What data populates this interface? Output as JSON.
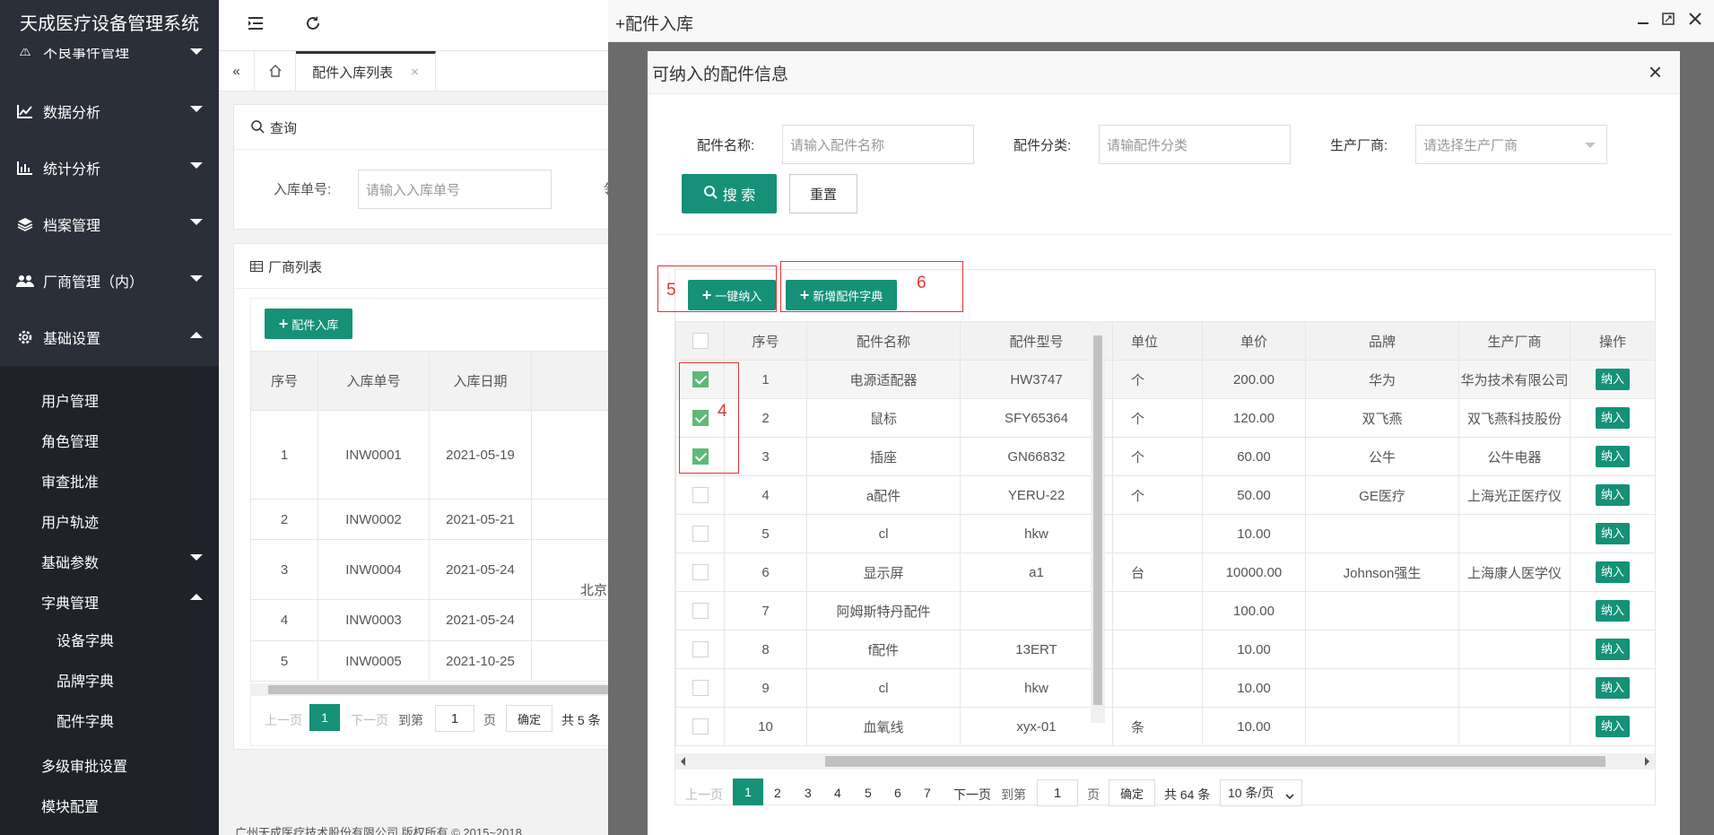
{
  "app": {
    "title": "天成医疗设备管理系统"
  },
  "sidebar": {
    "items": [
      {
        "label": "不良事件管理",
        "icon": "warning-icon"
      },
      {
        "label": "数据分析",
        "icon": "line-chart-icon"
      },
      {
        "label": "统计分析",
        "icon": "bar-chart-icon"
      },
      {
        "label": "档案管理",
        "icon": "layers-icon"
      },
      {
        "label": "厂商管理（内）",
        "icon": "users-icon"
      },
      {
        "label": "基础设置",
        "icon": "gear-icon"
      }
    ],
    "sub": [
      "用户管理",
      "角色管理",
      "审查批准",
      "用户轨迹",
      "基础参数",
      "字典管理"
    ],
    "sub2": [
      "设备字典",
      "品牌字典",
      "配件字典"
    ],
    "sub3": [
      "多级审批设置",
      "模块配置"
    ]
  },
  "tabs": {
    "active": "配件入库列表",
    "close": "×"
  },
  "query": {
    "title": "查询",
    "label": "入库单号:",
    "placeholder": "请输入入库单号",
    "cut": "领"
  },
  "list": {
    "title": "厂商列表",
    "add_btn": "配件入库",
    "headers": [
      "序号",
      "入库单号",
      "入库日期"
    ],
    "rows": [
      {
        "no": "1",
        "code": "INW0001",
        "date": "2021-05-19"
      },
      {
        "no": "2",
        "code": "INW0002",
        "date": "2021-05-21"
      },
      {
        "no": "3",
        "code": "INW0004",
        "date": "2021-05-24"
      },
      {
        "no": "4",
        "code": "INW0003",
        "date": "2021-05-24"
      },
      {
        "no": "5",
        "code": "INW0005",
        "date": "2021-10-25"
      }
    ],
    "extra": "北京六",
    "pager": {
      "prev": "上一页",
      "page": "1",
      "next": "下一页",
      "goto": "到第",
      "input": "1",
      "unit": "页",
      "confirm": "确定",
      "total": "共 5 条"
    }
  },
  "footer": "广州天成医疗技术股份有限公司 版权所有 © 2015~2018",
  "layer": {
    "title": "+配件入库"
  },
  "dialog": {
    "title": "可纳入的配件信息",
    "close": "×",
    "filters": {
      "name_label": "配件名称:",
      "name_ph": "请输入配件名称",
      "cat_label": "配件分类:",
      "cat_ph": "请输配件分类",
      "maker_label": "生产厂商:",
      "maker_ph": "请选择生产厂商"
    },
    "search_btn": "搜 索",
    "reset_btn": "重置",
    "batch_btn": "一键纳入",
    "new_btn": "新增配件字典",
    "annotations": [
      "5",
      "6",
      "4"
    ],
    "headers": [
      "序号",
      "配件名称",
      "配件型号",
      "单位",
      "单价",
      "品牌",
      "生产厂商",
      "操作"
    ],
    "rows": [
      {
        "checked": true,
        "no": "1",
        "name": "电源适配器",
        "model": "HW3747",
        "unit": "个",
        "price": "200.00",
        "brand": "华为",
        "maker": "华为技术有限公司",
        "op": "纳入"
      },
      {
        "checked": true,
        "no": "2",
        "name": "鼠标",
        "model": "SFY65364",
        "unit": "个",
        "price": "120.00",
        "brand": "双飞燕",
        "maker": "双飞燕科技股份",
        "op": "纳入"
      },
      {
        "checked": true,
        "no": "3",
        "name": "插座",
        "model": "GN66832",
        "unit": "个",
        "price": "60.00",
        "brand": "公牛",
        "maker": "公牛电器",
        "op": "纳入"
      },
      {
        "checked": false,
        "no": "4",
        "name": "a配件",
        "model": "YERU-22",
        "unit": "个",
        "price": "50.00",
        "brand": "GE医疗",
        "maker": "上海光正医疗仪",
        "op": "纳入"
      },
      {
        "checked": false,
        "no": "5",
        "name": "cl",
        "model": "hkw",
        "unit": "",
        "price": "10.00",
        "brand": "",
        "maker": "",
        "op": "纳入"
      },
      {
        "checked": false,
        "no": "6",
        "name": "显示屏",
        "model": "a1",
        "unit": "台",
        "price": "10000.00",
        "brand": "Johnson强生",
        "maker": "上海康人医学仪",
        "op": "纳入"
      },
      {
        "checked": false,
        "no": "7",
        "name": "阿姆斯特丹配件",
        "model": "",
        "unit": "",
        "price": "100.00",
        "brand": "",
        "maker": "",
        "op": "纳入"
      },
      {
        "checked": false,
        "no": "8",
        "name": "f配件",
        "model": "13ERT",
        "unit": "",
        "price": "10.00",
        "brand": "",
        "maker": "",
        "op": "纳入"
      },
      {
        "checked": false,
        "no": "9",
        "name": "cl",
        "model": "hkw",
        "unit": "",
        "price": "10.00",
        "brand": "",
        "maker": "",
        "op": "纳入"
      },
      {
        "checked": false,
        "no": "10",
        "name": "血氧线",
        "model": "xyx-01",
        "unit": "条",
        "price": "10.00",
        "brand": "",
        "maker": "",
        "op": "纳入"
      }
    ],
    "pager": {
      "prev": "上一页",
      "pages": [
        "1",
        "2",
        "3",
        "4",
        "5",
        "6",
        "7"
      ],
      "next": "下一页",
      "goto": "到第",
      "input": "1",
      "unit": "页",
      "confirm": "确定",
      "total": "共 64 条",
      "size": "10 条/页"
    }
  }
}
